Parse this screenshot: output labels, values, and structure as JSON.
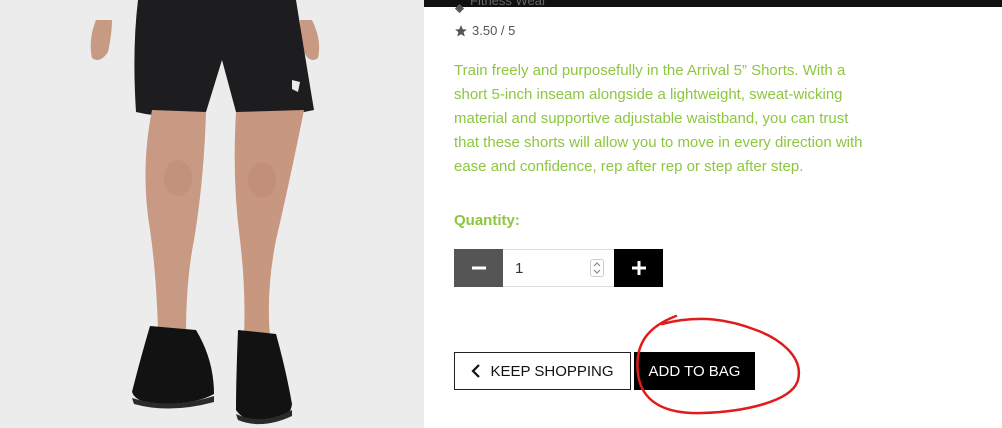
{
  "product": {
    "category": "Fitness Wear",
    "rating": "3.50 / 5",
    "description": "Train freely and purposefully in the Arrival 5” Shorts. With a short 5-inch inseam alongside a lightweight, sweat-wicking material and supportive adjustable waistband, you can trust that these shorts will allow you to move in every direction with ease and confidence, rep after rep or step after step."
  },
  "quantity": {
    "label": "Quantity:",
    "value": "1",
    "minus_icon": "minus-icon",
    "plus_icon": "plus-icon"
  },
  "actions": {
    "keep_shopping": "KEEP SHOPPING",
    "add_to_bag": "ADD TO BAG"
  },
  "colors": {
    "accent_green": "#8dc63f",
    "annotation_red": "#e01b1b"
  }
}
